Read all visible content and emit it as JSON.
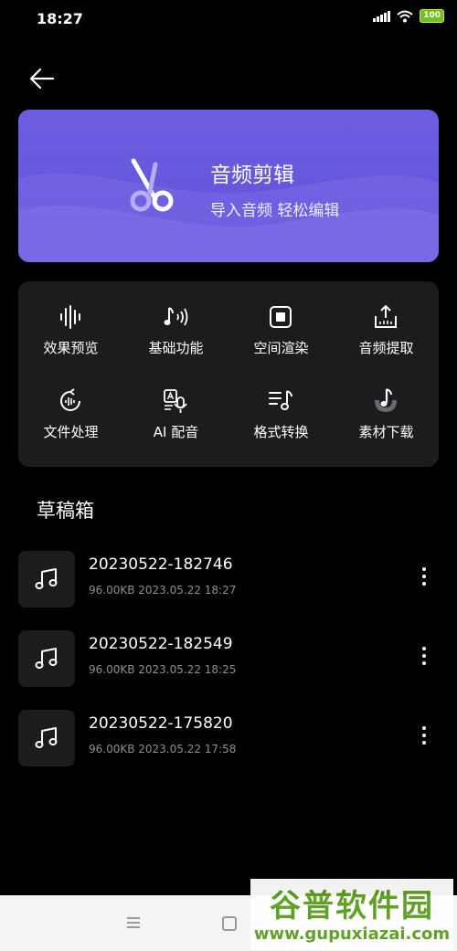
{
  "status": {
    "time": "18:27",
    "battery": "100"
  },
  "banner": {
    "title": "音频剪辑",
    "subtitle": "导入音频 轻松编辑",
    "color": "#6d5ee2"
  },
  "features": [
    {
      "label": "效果预览",
      "icon": "waveform-icon"
    },
    {
      "label": "基础功能",
      "icon": "music-note-sound-icon"
    },
    {
      "label": "空间渲染",
      "icon": "spatial-render-icon"
    },
    {
      "label": "音频提取",
      "icon": "audio-extract-icon"
    },
    {
      "label": "文件处理",
      "icon": "file-process-icon"
    },
    {
      "label": "AI 配音",
      "icon": "ai-dubbing-icon"
    },
    {
      "label": "格式转换",
      "icon": "format-convert-icon"
    },
    {
      "label": "素材下载",
      "icon": "material-download-icon"
    }
  ],
  "drafts": {
    "title": "草稿箱",
    "items": [
      {
        "name": "20230522-182746",
        "meta": "96.00KB 2023.05.22 18:27"
      },
      {
        "name": "20230522-182549",
        "meta": "96.00KB 2023.05.22 18:25"
      },
      {
        "name": "20230522-175820",
        "meta": "96.00KB 2023.05.22 17:58"
      }
    ]
  },
  "watermark": {
    "text": "谷普软件园",
    "url": "www.gupuxiazai.com"
  }
}
